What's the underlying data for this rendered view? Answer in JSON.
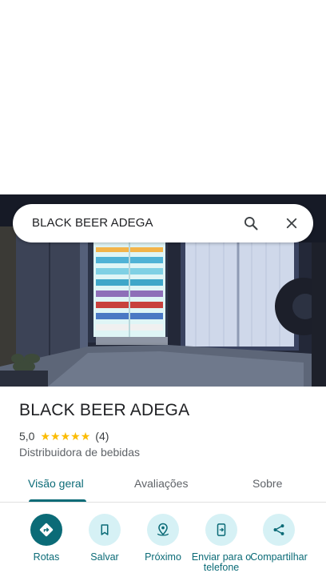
{
  "search": {
    "query": "BLACK BEER ADEGA",
    "search_icon": "search-icon",
    "close_icon": "close-icon"
  },
  "place": {
    "name": "BLACK BEER ADEGA",
    "rating": "5,0",
    "stars": 5,
    "review_count": "(4)",
    "category": "Distribuidora de bebidas"
  },
  "tabs": [
    {
      "label": "Visão geral",
      "active": true
    },
    {
      "label": "Avaliações",
      "active": false
    },
    {
      "label": "Sobre",
      "active": false
    }
  ],
  "actions": [
    {
      "label": "Rotas",
      "icon": "directions-icon"
    },
    {
      "label": "Salvar",
      "icon": "bookmark-icon"
    },
    {
      "label": "Próximo",
      "icon": "nearby-icon"
    },
    {
      "label": "Enviar para o telefone",
      "icon": "send-to-phone-icon"
    },
    {
      "label": "Compartilhar",
      "icon": "share-icon"
    }
  ],
  "colors": {
    "accent": "#0b6b77",
    "accent_light": "#d6f1f5",
    "star": "#fbbc04"
  }
}
